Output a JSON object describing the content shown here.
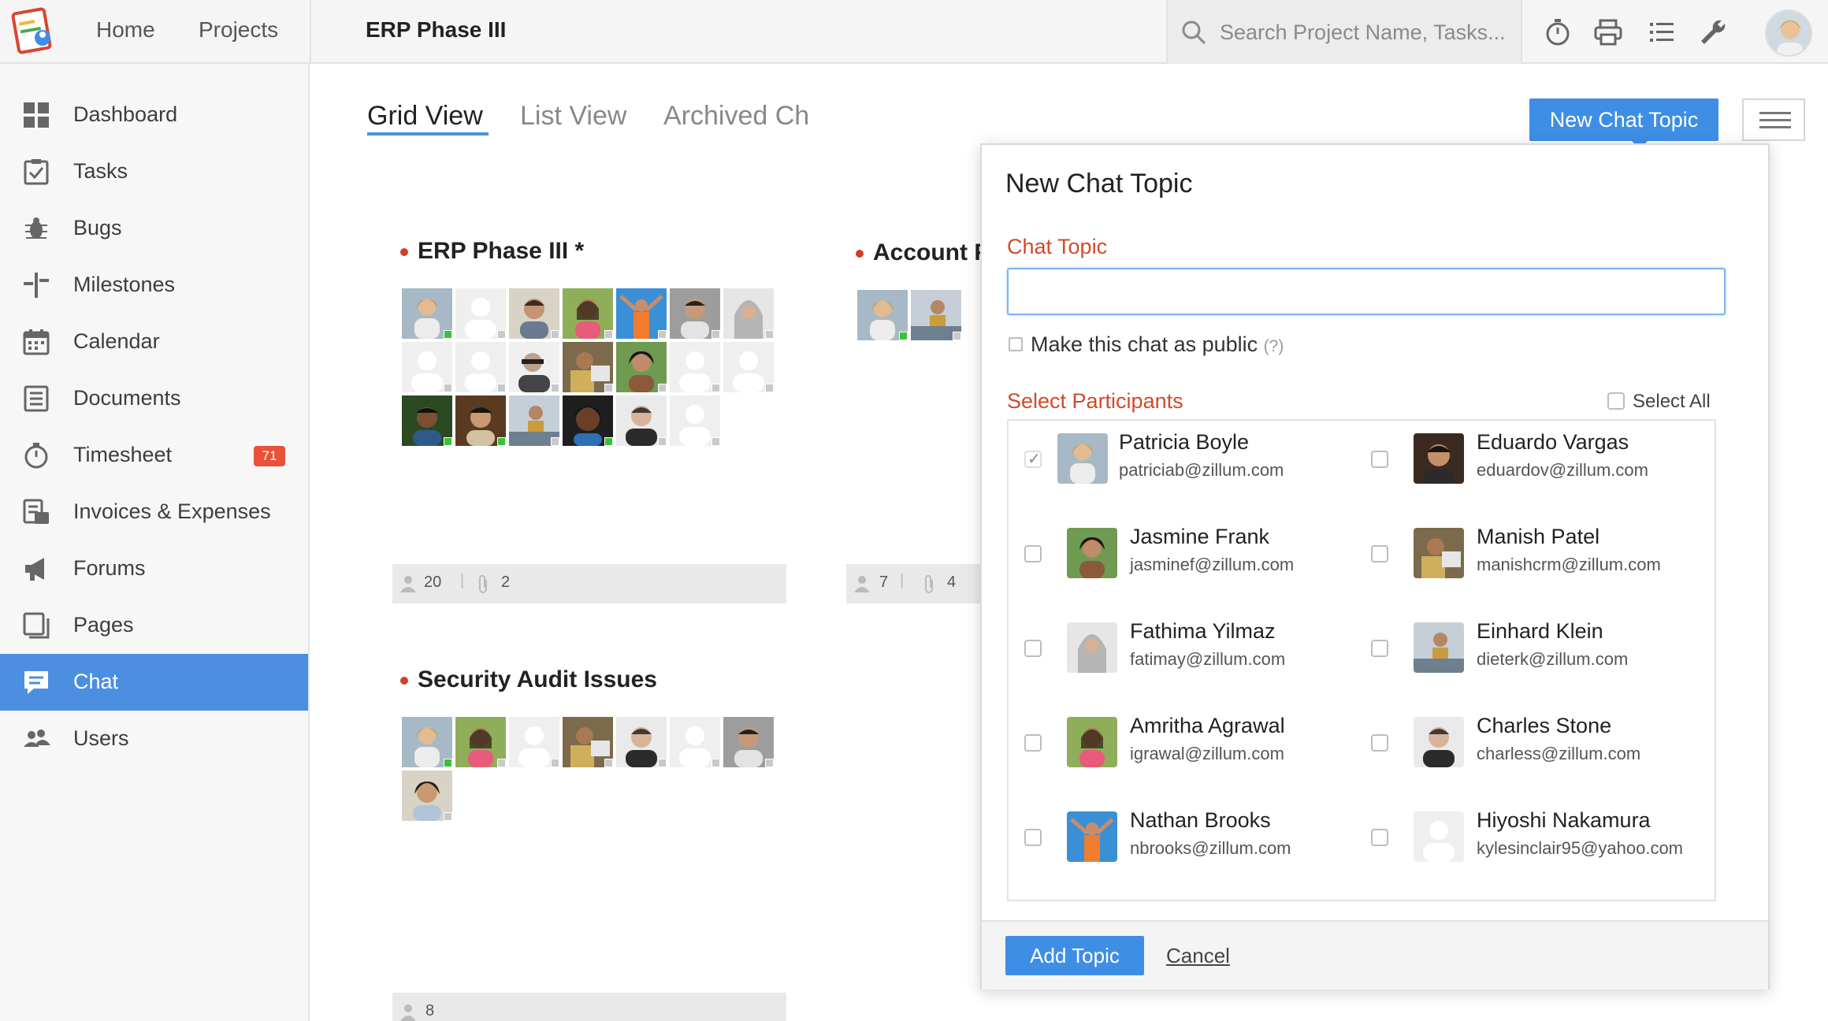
{
  "topbar": {
    "nav": [
      "Home",
      "Projects"
    ],
    "project_title": "ERP Phase III",
    "search_placeholder": "Search Project Name, Tasks...",
    "icons": [
      "timer-icon",
      "print-icon",
      "list-icon",
      "wrench-icon"
    ]
  },
  "sidebar": {
    "items": [
      {
        "label": "Dashboard",
        "icon": "dashboard-icon"
      },
      {
        "label": "Tasks",
        "icon": "tasks-icon"
      },
      {
        "label": "Bugs",
        "icon": "bug-icon"
      },
      {
        "label": "Milestones",
        "icon": "milestone-icon"
      },
      {
        "label": "Calendar",
        "icon": "calendar-icon"
      },
      {
        "label": "Documents",
        "icon": "document-icon"
      },
      {
        "label": "Timesheet",
        "icon": "timer-icon",
        "badge": "71"
      },
      {
        "label": "Invoices & Expenses",
        "icon": "invoice-icon"
      },
      {
        "label": "Forums",
        "icon": "megaphone-icon"
      },
      {
        "label": "Pages",
        "icon": "pages-icon"
      },
      {
        "label": "Chat",
        "icon": "chat-icon",
        "active": true
      },
      {
        "label": "Users",
        "icon": "users-icon"
      }
    ]
  },
  "tabs": [
    "Grid View",
    "List View",
    "Archived Ch"
  ],
  "new_chat_button": "New Chat Topic",
  "cards": [
    {
      "title": "ERP Phase III *",
      "members": "20",
      "attachments": "2"
    },
    {
      "title": "Account F",
      "members": "7",
      "attachments": "4"
    },
    {
      "title": "Security Audit Issues",
      "members": "8"
    }
  ],
  "popup": {
    "title": "New Chat Topic",
    "topic_label": "Chat Topic",
    "topic_value": "",
    "public_label": "Make this chat as public",
    "public_hint": "(?)",
    "participants_label": "Select Participants",
    "select_all": "Select All",
    "participants": [
      {
        "name": "Patricia Boyle",
        "email": "patriciab@zillum.com",
        "checked": true
      },
      {
        "name": "Eduardo Vargas",
        "email": "eduardov@zillum.com",
        "checked": false
      },
      {
        "name": "Jasmine Frank",
        "email": "jasminef@zillum.com",
        "checked": false
      },
      {
        "name": "Manish Patel",
        "email": "manishcrm@zillum.com",
        "checked": false
      },
      {
        "name": "Fathima Yilmaz",
        "email": "fatimay@zillum.com",
        "checked": false
      },
      {
        "name": "Einhard Klein",
        "email": "dieterk@zillum.com",
        "checked": false
      },
      {
        "name": "Amritha Agrawal",
        "email": "igrawal@zillum.com",
        "checked": false
      },
      {
        "name": "Charles Stone",
        "email": "charless@zillum.com",
        "checked": false
      },
      {
        "name": "Nathan Brooks",
        "email": "nbrooks@zillum.com",
        "checked": false
      },
      {
        "name": "Hiyoshi Nakamura",
        "email": "kylesinclair95@yahoo.com",
        "checked": false
      }
    ],
    "add_button": "Add Topic",
    "cancel": "Cancel"
  },
  "colors": {
    "accent": "#3e8ee5",
    "label_red": "#d24a2a",
    "online": "#3cbf3c",
    "badge": "#e8523a"
  }
}
